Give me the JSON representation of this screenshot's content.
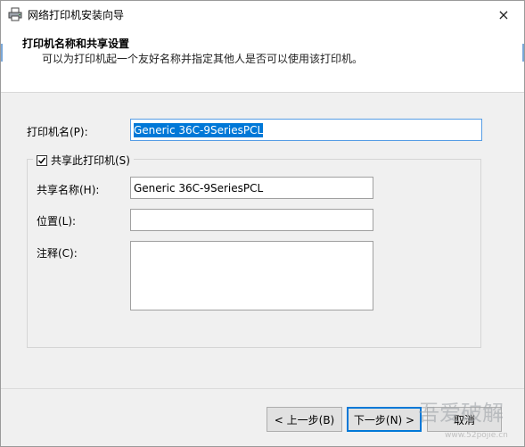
{
  "window": {
    "title": "网络打印机安装向导",
    "close_icon": "×"
  },
  "header": {
    "title": "打印机名称和共享设置",
    "subtitle": "可以为打印机起一个友好名称并指定其他人是否可以使用该打印机。"
  },
  "form": {
    "printer_name_label": "打印机名(P):",
    "printer_name_value": "Generic 36C-9SeriesPCL",
    "share_checkbox_label": "共享此打印机(S)",
    "share_checked": true,
    "share_name_label": "共享名称(H):",
    "share_name_value": "Generic 36C-9SeriesPCL",
    "location_label": "位置(L):",
    "location_value": "",
    "comment_label": "注释(C):",
    "comment_value": ""
  },
  "buttons": {
    "back": "< 上一步(B)",
    "next": "下一步(N) >",
    "cancel": "取消"
  },
  "watermark": {
    "url": "www.52pojie.cn"
  },
  "colors": {
    "selection": "#0078d7",
    "focus_border": "#569de5"
  }
}
